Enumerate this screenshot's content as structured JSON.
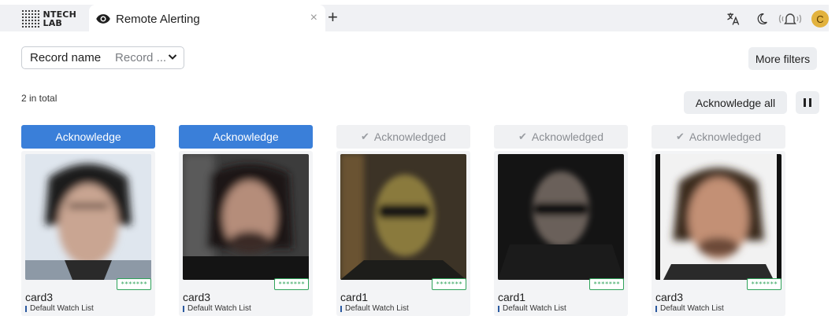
{
  "app": {
    "logo_text_top": "NTECH",
    "logo_text_bottom": "LAB",
    "tab_title": "Remote Alerting",
    "tab_close": "×",
    "tab_add": "+",
    "avatar_letter": "C",
    "icons": [
      "visibility-icon",
      "close-icon",
      "add-icon",
      "translate-icon",
      "moon-icon",
      "audio-alert-icon",
      "avatar"
    ]
  },
  "filters": {
    "record_label": "Record name",
    "record_value": "Record ...",
    "more_filters": "More filters"
  },
  "summary": {
    "total": "2 in total",
    "acknowledge_all": "Acknowledge all"
  },
  "colors": {
    "primary": "#3a7fd9",
    "badge_green": "#2fa35a",
    "avatar": "#e2b23e",
    "watchlist_marker": "#2c5aa0"
  },
  "cards": [
    {
      "button": "Acknowledge",
      "status": "unacknowledged",
      "badge": "*******",
      "name": "card3",
      "watch_list": "Default Watch List"
    },
    {
      "button": "Acknowledge",
      "status": "unacknowledged",
      "badge": "*******",
      "name": "card3",
      "watch_list": "Default Watch List"
    },
    {
      "button": "Acknowledged",
      "status": "acknowledged",
      "badge": "*******",
      "name": "card1",
      "watch_list": "Default Watch List"
    },
    {
      "button": "Acknowledged",
      "status": "acknowledged",
      "badge": "*******",
      "name": "card1",
      "watch_list": "Default Watch List"
    },
    {
      "button": "Acknowledged",
      "status": "acknowledged",
      "badge": "*******",
      "name": "card3",
      "watch_list": "Default Watch List"
    }
  ]
}
